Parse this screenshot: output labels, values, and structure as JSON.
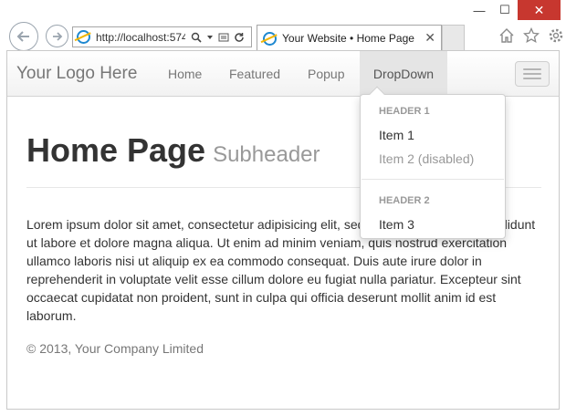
{
  "browser": {
    "address_url": "http://localhost:574",
    "tab_title": "Your Website • Home Page",
    "window_buttons": {
      "minimize": "—",
      "maximize": "☐",
      "close": "✕"
    },
    "icons": [
      "back-arrow-icon",
      "forward-arrow-icon",
      "search-icon",
      "compat-icon",
      "refresh-icon",
      "home-icon",
      "star-icon",
      "gear-icon"
    ]
  },
  "site": {
    "brand": "Your Logo Here",
    "nav": {
      "home": "Home",
      "featured": "Featured",
      "popup": "Popup",
      "dropdown": "DropDown"
    },
    "dropdown_menu": {
      "header1": "HEADER 1",
      "item1": "Item 1",
      "item2": "Item 2 (disabled)",
      "header2": "HEADER 2",
      "item3": "Item 3"
    },
    "page_title": "Home Page",
    "page_subheader": "Subheader",
    "body_text": "Lorem ipsum dolor sit amet, consectetur adipisicing elit, sed do eiusmod tempor incididunt ut labore et dolore magna aliqua. Ut enim ad minim veniam, quis nostrud exercitation ullamco laboris nisi ut aliquip ex ea commodo consequat. Duis aute irure dolor in reprehenderit in voluptate velit esse cillum dolore eu fugiat nulla pariatur. Excepteur sint occaecat cupidatat non proident, sunt in culpa qui officia deserunt mollit anim id est laborum.",
    "footer": "© 2013, Your Company Limited"
  },
  "colors": {
    "close_button": "#c7372f",
    "active_nav_bg": "#e5e5e5",
    "text_dark": "#333333",
    "text_muted": "#999999"
  }
}
